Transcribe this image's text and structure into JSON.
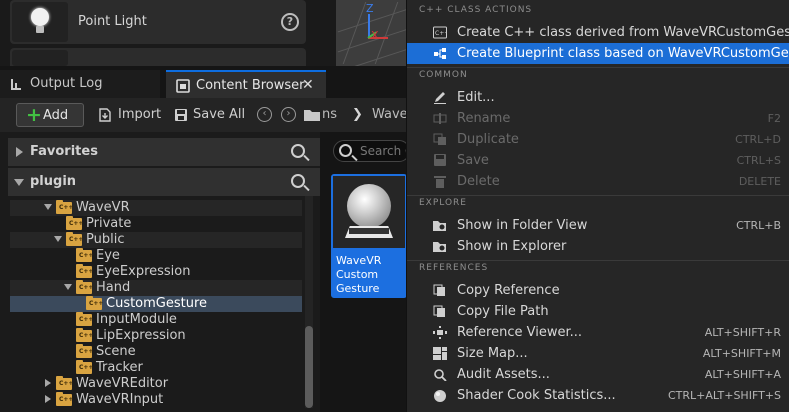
{
  "place_actors": {
    "items": [
      {
        "label": "Point Light",
        "icon": "lightbulb-icon"
      },
      {
        "label": "",
        "icon": ""
      }
    ]
  },
  "viewport": {
    "axis_z": "Z",
    "axis_x": "X"
  },
  "tabs": [
    {
      "label": "Output Log",
      "icon": "output-log-icon"
    },
    {
      "label": "Content Browser",
      "icon": "content-browser-icon",
      "active": true
    }
  ],
  "toolbar": {
    "add_label": "Add",
    "import_label": "Import",
    "save_all_label": "Save All",
    "path": [
      "ns",
      "Wave"
    ]
  },
  "sections": {
    "favorites": "Favorites",
    "plugin": "plugin"
  },
  "tree": [
    {
      "label": "WaveVR",
      "expanded": true
    },
    {
      "label": "Private"
    },
    {
      "label": "Public",
      "expanded": true
    },
    {
      "label": "Eye"
    },
    {
      "label": "EyeExpression"
    },
    {
      "label": "Hand",
      "expanded": true
    },
    {
      "label": "CustomGesture",
      "selected": true
    },
    {
      "label": "InputModule"
    },
    {
      "label": "LipExpression"
    },
    {
      "label": "Scene"
    },
    {
      "label": "Tracker"
    },
    {
      "label": "WaveVREditor"
    },
    {
      "label": "WaveVRInput"
    }
  ],
  "asset_search_placeholder": "Search C",
  "asset": {
    "name": "WaveVR Custom Gesture"
  },
  "menu": {
    "sections": {
      "cpp": "C++ CLASS ACTIONS",
      "common": "COMMON",
      "explore": "EXPLORE",
      "references": "REFERENCES"
    },
    "cpp_items": [
      {
        "label": "Create C++ class derived from WaveVRCustomGesture",
        "icon": "cpp-class-icon",
        "shortcut": ""
      },
      {
        "label": "Create Blueprint class based on WaveVRCustomGesture",
        "icon": "blueprint-class-icon",
        "shortcut": "",
        "highlighted": true
      }
    ],
    "common_items": [
      {
        "label": "Edit...",
        "icon": "edit-icon",
        "shortcut": ""
      },
      {
        "label": "Rename",
        "icon": "rename-icon",
        "shortcut": "F2",
        "disabled": true
      },
      {
        "label": "Duplicate",
        "icon": "duplicate-icon",
        "shortcut": "CTRL+D",
        "disabled": true
      },
      {
        "label": "Save",
        "icon": "save-icon",
        "shortcut": "CTRL+S",
        "disabled": true
      },
      {
        "label": "Delete",
        "icon": "delete-icon",
        "shortcut": "DELETE",
        "disabled": true
      }
    ],
    "explore_items": [
      {
        "label": "Show in Folder View",
        "icon": "folder-search-icon",
        "shortcut": "CTRL+B"
      },
      {
        "label": "Show in Explorer",
        "icon": "explorer-icon",
        "shortcut": ""
      }
    ],
    "reference_items": [
      {
        "label": "Copy Reference",
        "icon": "copy-icon",
        "shortcut": ""
      },
      {
        "label": "Copy File Path",
        "icon": "copy-icon",
        "shortcut": ""
      },
      {
        "label": "Reference Viewer...",
        "icon": "reference-viewer-icon",
        "shortcut": "ALT+SHIFT+R"
      },
      {
        "label": "Size Map...",
        "icon": "size-map-icon",
        "shortcut": "ALT+SHIFT+M"
      },
      {
        "label": "Audit Assets...",
        "icon": "audit-icon",
        "shortcut": "ALT+SHIFT+A"
      },
      {
        "label": "Shader Cook Statistics...",
        "icon": "shader-stats-icon",
        "shortcut": "CTRL+ALT+SHIFT+S"
      }
    ]
  },
  "colors": {
    "accent": "#1c6ed6",
    "folder": "#d9a441",
    "add_plus": "#42c043"
  }
}
